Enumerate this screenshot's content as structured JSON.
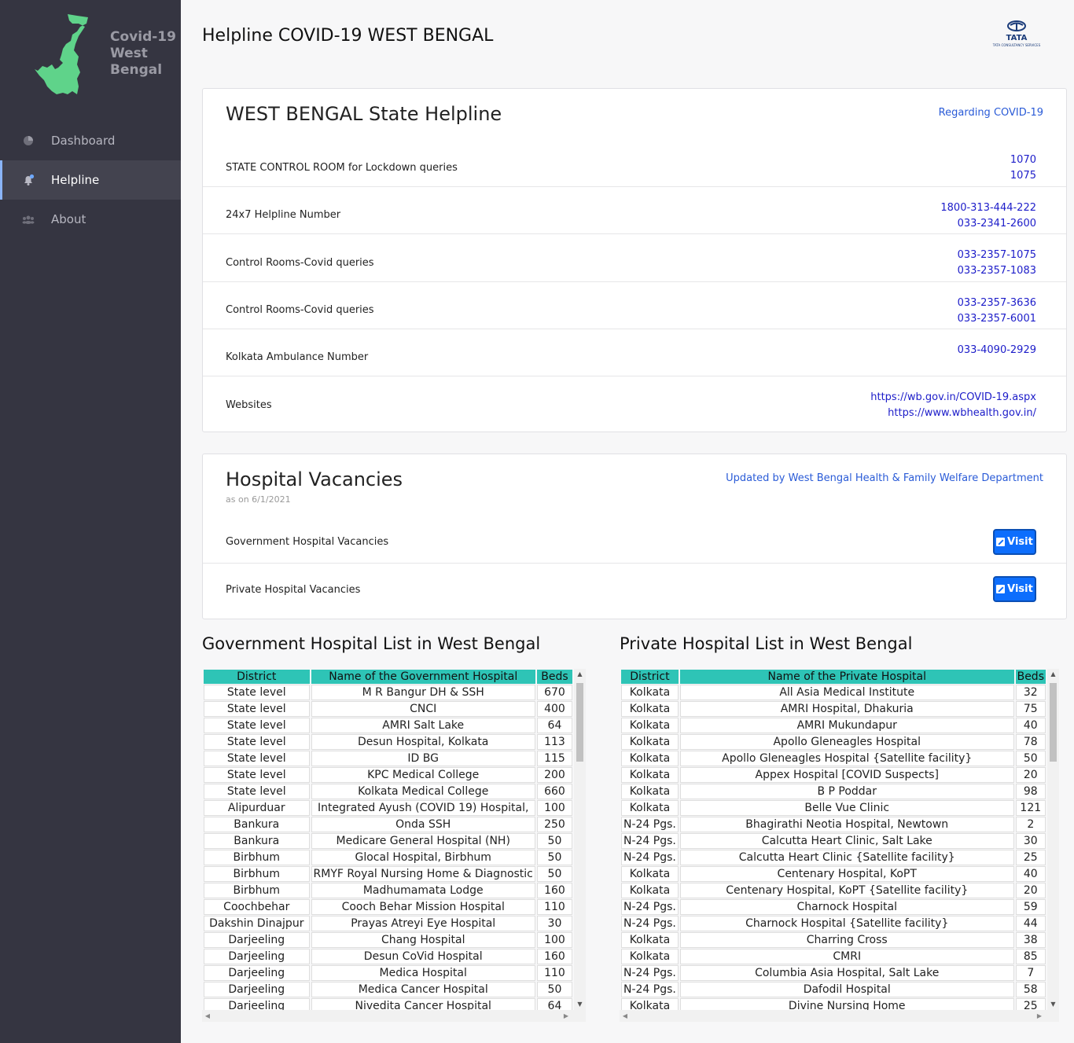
{
  "sidebar": {
    "brand": "Covid-19 West Bengal",
    "items": [
      {
        "label": "Dashboard",
        "icon": "pie-chart-icon",
        "active": false
      },
      {
        "label": "Helpline",
        "icon": "bell-icon",
        "active": true
      },
      {
        "label": "About",
        "icon": "users-icon",
        "active": false
      }
    ]
  },
  "header": {
    "title": "Helpline COVID-19 WEST BENGAL",
    "logo_text": "TATA",
    "logo_sub": "TATA CONSULTANCY SERVICES"
  },
  "helpline": {
    "title": "WEST BENGAL State Helpline",
    "link": "Regarding COVID-19",
    "rows": [
      {
        "label": "STATE CONTROL ROOM for Lockdown queries",
        "values": [
          "1070",
          "1075"
        ]
      },
      {
        "label": "24x7 Helpline Number",
        "values": [
          "1800-313-444-222",
          "033-2341-2600"
        ]
      },
      {
        "label": "Control Rooms-Covid queries",
        "values": [
          "033-2357-1075",
          "033-2357-1083"
        ]
      },
      {
        "label": "Control Rooms-Covid queries",
        "values": [
          "033-2357-3636",
          "033-2357-6001"
        ]
      },
      {
        "label": "Kolkata Ambulance Number",
        "values": [
          "033-4090-2929"
        ]
      },
      {
        "label": "Websites",
        "values": [
          "https://wb.gov.in/COVID-19.aspx",
          "https://www.wbhealth.gov.in/"
        ]
      }
    ]
  },
  "vacancies": {
    "title": "Hospital Vacancies",
    "subtitle": "as on 6/1/2021",
    "link": "Updated by West Bengal Health & Family Welfare Department",
    "rows": [
      {
        "label": "Government Hospital Vacancies",
        "button": "Visit"
      },
      {
        "label": "Private Hospital Vacancies",
        "button": "Visit"
      }
    ]
  },
  "gov_list": {
    "title": "Government Hospital List in West Bengal",
    "headers": [
      "District",
      "Name of the Government Hospital",
      "Beds"
    ],
    "rows": [
      [
        "State level",
        "M R Bangur DH & SSH",
        "670"
      ],
      [
        "State level",
        "CNCI",
        "400"
      ],
      [
        "State level",
        "AMRI Salt Lake",
        "64"
      ],
      [
        "State level",
        "Desun Hospital, Kolkata",
        "113"
      ],
      [
        "State level",
        "ID BG",
        "115"
      ],
      [
        "State level",
        "KPC Medical College",
        "200"
      ],
      [
        "State level",
        "Kolkata Medical College",
        "660"
      ],
      [
        "Alipurduar",
        "Integrated Ayush (COVID 19) Hospital,",
        "100"
      ],
      [
        "Bankura",
        "Onda SSH",
        "250"
      ],
      [
        "Bankura",
        "Medicare General Hospital (NH)",
        "50"
      ],
      [
        "Birbhum",
        "Glocal Hospital, Birbhum",
        "50"
      ],
      [
        "Birbhum",
        "RMYF Royal Nursing Home & Diagnostic",
        "50"
      ],
      [
        "Birbhum",
        "Madhumamata Lodge",
        "160"
      ],
      [
        "Coochbehar",
        "Cooch Behar Mission Hospital",
        "110"
      ],
      [
        "Dakshin Dinajpur",
        "Prayas Atreyi Eye Hospital",
        "30"
      ],
      [
        "Darjeeling",
        "Chang Hospital",
        "100"
      ],
      [
        "Darjeeling",
        "Desun CoVid Hospital",
        "160"
      ],
      [
        "Darjeeling",
        "Medica Hospital",
        "110"
      ],
      [
        "Darjeeling",
        "Medica Cancer Hospital",
        "50"
      ],
      [
        "Darjeeling",
        "Nivedita Cancer Hospital",
        "64"
      ]
    ]
  },
  "pvt_list": {
    "title": "Private Hospital List in West Bengal",
    "headers": [
      "District",
      "Name of the Private Hospital",
      "Beds"
    ],
    "rows": [
      [
        "Kolkata",
        "All Asia Medical Institute",
        "32"
      ],
      [
        "Kolkata",
        "AMRI Hospital, Dhakuria",
        "75"
      ],
      [
        "Kolkata",
        "AMRI Mukundapur",
        "40"
      ],
      [
        "Kolkata",
        "Apollo Gleneagles Hospital",
        "78"
      ],
      [
        "Kolkata",
        "Apollo Gleneagles Hospital {Satellite facility}",
        "50"
      ],
      [
        "Kolkata",
        "Appex Hospital [COVID Suspects]",
        "20"
      ],
      [
        "Kolkata",
        "B P Poddar",
        "98"
      ],
      [
        "Kolkata",
        "Belle Vue Clinic",
        "121"
      ],
      [
        "N-24 Pgs.",
        "Bhagirathi Neotia Hospital, Newtown",
        "2"
      ],
      [
        "N-24 Pgs.",
        "Calcutta Heart Clinic, Salt Lake",
        "30"
      ],
      [
        "N-24 Pgs.",
        "Calcutta Heart Clinic {Satellite facility}",
        "25"
      ],
      [
        "Kolkata",
        "Centenary Hospital, KoPT",
        "40"
      ],
      [
        "Kolkata",
        "Centenary Hospital, KoPT {Satellite facility}",
        "20"
      ],
      [
        "N-24 Pgs.",
        "Charnock Hospital",
        "59"
      ],
      [
        "N-24 Pgs.",
        "Charnock Hospital {Satellite facility}",
        "44"
      ],
      [
        "Kolkata",
        "Charring Cross",
        "38"
      ],
      [
        "Kolkata",
        "CMRI",
        "85"
      ],
      [
        "N-24 Pgs.",
        "Columbia Asia Hospital, Salt Lake",
        "7"
      ],
      [
        "N-24 Pgs.",
        "Dafodil Hospital",
        "58"
      ],
      [
        "Kolkata",
        "Divine Nursing Home",
        "25"
      ]
    ]
  }
}
